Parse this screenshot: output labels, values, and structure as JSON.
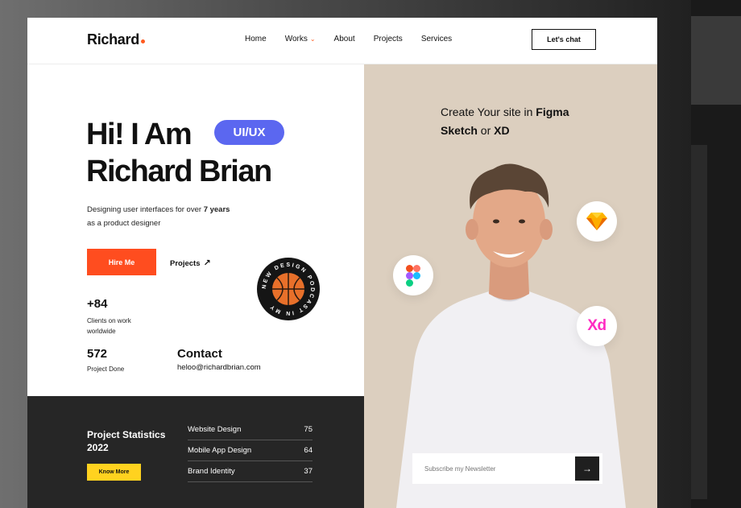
{
  "nav": {
    "logo": "Richard",
    "links": [
      "Home",
      "Works",
      "About",
      "Projects",
      "Services"
    ],
    "chat_label": "Let's chat"
  },
  "hero": {
    "line1": "Hi! I Am",
    "badge": "UI/UX",
    "line2": "Richard Brian",
    "tagline_before": "Designing user interfaces for over ",
    "tagline_bold": "7 years",
    "tagline_after": "as a product designer",
    "hire_label": "Hire Me",
    "projects_label": "Projects",
    "podcast_text": "NEW DESIGN PODCAST IN MY"
  },
  "stats": {
    "clients_num": "+84",
    "clients_label": "Clients on work worldwide",
    "projects_num": "572",
    "projects_label": "Project Done"
  },
  "contact": {
    "title": "Contact",
    "email": "heloo@richardbrian.com"
  },
  "project_stats": {
    "title": "Project Statistics 2022",
    "button": "Know More",
    "rows": [
      {
        "label": "Website Design",
        "value": "75"
      },
      {
        "label": "Mobile App Design",
        "value": "64"
      },
      {
        "label": "Brand Identity",
        "value": "37"
      }
    ]
  },
  "promo": {
    "prefix": "Create Your site in ",
    "figma": "Figma",
    "sketch": "Sketch",
    "or": " or ",
    "xd": "XD"
  },
  "tools": {
    "xd_label": "Xd"
  },
  "newsletter": {
    "placeholder": "Subscribe my Newsletter"
  },
  "colors": {
    "accent": "#ff4d1f",
    "badge": "#5b67f0",
    "yellow": "#ffd21f",
    "beige": "#dccfbf",
    "dark": "#262626"
  }
}
